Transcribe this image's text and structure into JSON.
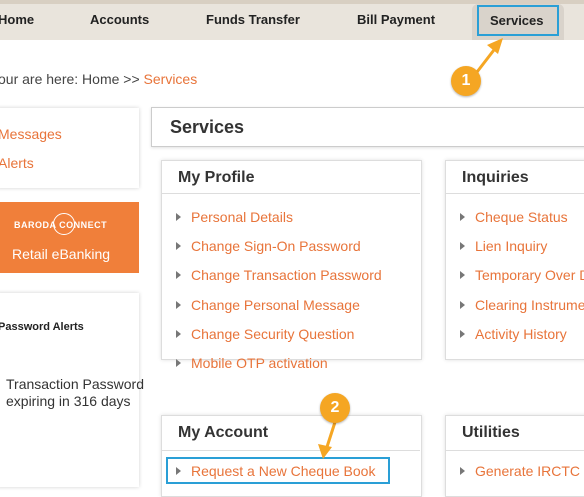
{
  "nav": {
    "tabs": [
      "Home",
      "Accounts",
      "Funds Transfer",
      "Bill Payment"
    ],
    "active_tab": "Services"
  },
  "breadcrumb": {
    "prefix": "our are here: Home >> ",
    "current": "Services"
  },
  "sidebar": {
    "links": [
      "Messages",
      "Alerts"
    ],
    "banner": {
      "brand": "BARODA CONNECT",
      "subtitle": "Retail eBanking"
    },
    "password_alerts": {
      "title": "Password Alerts",
      "message": "Transaction Password expiring in 316 days"
    }
  },
  "main": {
    "title": "Services",
    "my_profile": {
      "title": "My Profile",
      "links": [
        "Personal Details",
        "Change Sign-On Password",
        "Change Transaction Password",
        "Change Personal Message",
        "Change Security Question",
        "Mobile OTP activation"
      ]
    },
    "inquiries": {
      "title": "Inquiries",
      "links": [
        "Cheque Status",
        "Lien Inquiry",
        "Temporary Over D",
        "Clearing Instrume",
        "Activity History"
      ]
    },
    "my_account": {
      "title": "My Account",
      "links": [
        "Request a New Cheque Book"
      ]
    },
    "utilities": {
      "title": "Utilities",
      "links": [
        "Generate IRCTC"
      ]
    }
  },
  "annotations": {
    "step1": "1",
    "step2": "2",
    "highlight_color": "#2a9fd6",
    "badge_color": "#f5a623",
    "accent_color": "#e8743a"
  }
}
